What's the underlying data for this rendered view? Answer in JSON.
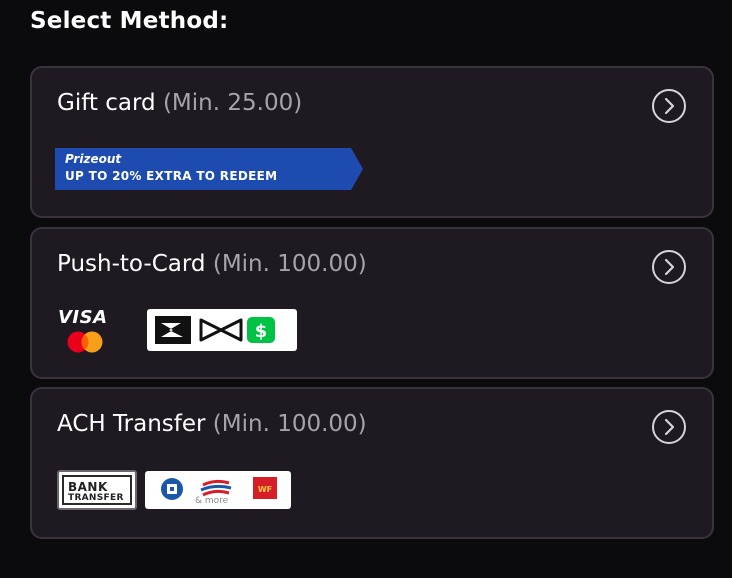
{
  "heading": "Select Method:",
  "methods": [
    {
      "title": "Gift card",
      "min": "(Min. 25.00)",
      "chevron_icon": "chevron-right-circle-icon",
      "banner": {
        "brand": "Prizeout",
        "tagline": "UP TO 20% EXTRA TO REDEEM",
        "color": "#1d4bb0"
      }
    },
    {
      "title": "Push-to-Card",
      "min": "(Min. 100.00)",
      "chevron_icon": "chevron-right-circle-icon",
      "logos": {
        "visa": "VISA",
        "icons": [
          "mastercard-icon",
          "skrill-icon",
          "bowtie-icon",
          "cash-app-icon"
        ]
      }
    },
    {
      "title": "ACH Transfer",
      "min": "(Min. 100.00)",
      "chevron_icon": "chevron-right-circle-icon",
      "logos": {
        "bank_line1": "BANK",
        "bank_line2": "TRANSFER",
        "more": "& more",
        "icons": [
          "bank-transfer-icon",
          "chase-icon",
          "bank-of-america-icon",
          "wells-fargo-icon"
        ]
      }
    }
  ],
  "colors": {
    "background": "#0b0a0d",
    "card": "#1f1922",
    "card_border": "#3a333d",
    "min_text": "#a8a3ab",
    "cash_app_green": "#00c244",
    "wells_fargo_red": "#d71e28"
  }
}
